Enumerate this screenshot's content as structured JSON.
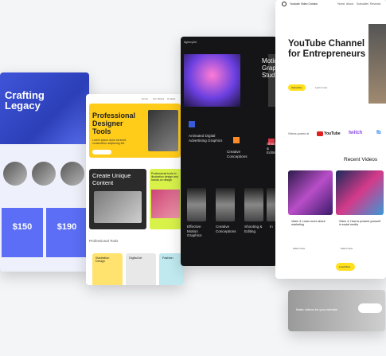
{
  "crafting": {
    "title": "Crafting Legacy",
    "prices": [
      "$150",
      "$190"
    ]
  },
  "designer": {
    "nav": [
      "Home",
      "Our Works",
      "Contact"
    ],
    "hero_title": "Professional Designer Tools",
    "hero_text": "Lorem ipsum dolor sit amet, consectetur adipiscing elit.",
    "create_title": "Create Unique Content",
    "green_text": "Professional tools to illustration design and hands-on design",
    "section_label": "Professional Tools",
    "tool_cards": [
      "Illustration Design",
      "Digital Art",
      "Fashion"
    ],
    "colors": {
      "yellow": "#ffcc1a",
      "green": "#d8f24a"
    }
  },
  "agency": {
    "brand": "AgencyAd",
    "hero_title": "Motion Graphics Studio",
    "labels": [
      "Animated Digital Advertising Graphics",
      "Creative Conceptions",
      "Shooting & Editing"
    ],
    "bottom_labels": [
      "Effective Motion Graphics",
      "Creative Conceptions",
      "Shooting & Editing",
      "In"
    ]
  },
  "youtube": {
    "brand": "Youtube Video Creator",
    "nav": [
      "Home",
      "About",
      "Subsidies",
      "Reviews"
    ],
    "hero_title": "YouTube Channel for Entrepreneurs",
    "subscribe": "Subscribe",
    "learn_more": "Learn more",
    "videos_on": "Videos posted at",
    "platforms": [
      "YouTube",
      "twitch",
      "fb"
    ],
    "recent_videos": "Recent Videos",
    "videos": [
      {
        "title": "Video 3: Learn more about marketing",
        "cta": "Watch Now"
      },
      {
        "title": "Video 4: How to present yourself in social media",
        "cta": "Watch Now"
      }
    ],
    "load_more": "Load More",
    "banner": "Make videos for your website",
    "colors": {
      "accent": "#ffe01f",
      "youtube_red": "#e02020"
    }
  }
}
